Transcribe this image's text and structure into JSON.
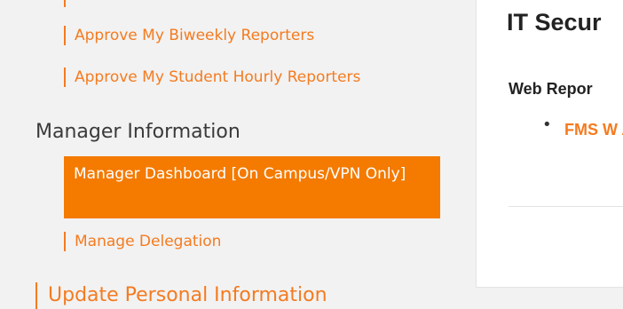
{
  "sidebar": {
    "approve_biweekly": "Approve My Biweekly Reporters",
    "approve_student_hourly": "Approve My Student Hourly Reporters",
    "manager_section_heading": "Manager Information",
    "manager_dashboard": "Manager Dashboard [On Campus/VPN Only]",
    "manage_delegation": "Manage Delegation",
    "update_personal_info": "Update Personal Information"
  },
  "main": {
    "title": "IT Secur",
    "subhead": "Web Repor",
    "bullet": "•",
    "link_text": "FMS W Acces"
  },
  "colors": {
    "accent": "#f47b20",
    "active_background": "#f47a00",
    "page_background": "#f2f2f2",
    "panel_background": "#ffffff"
  }
}
